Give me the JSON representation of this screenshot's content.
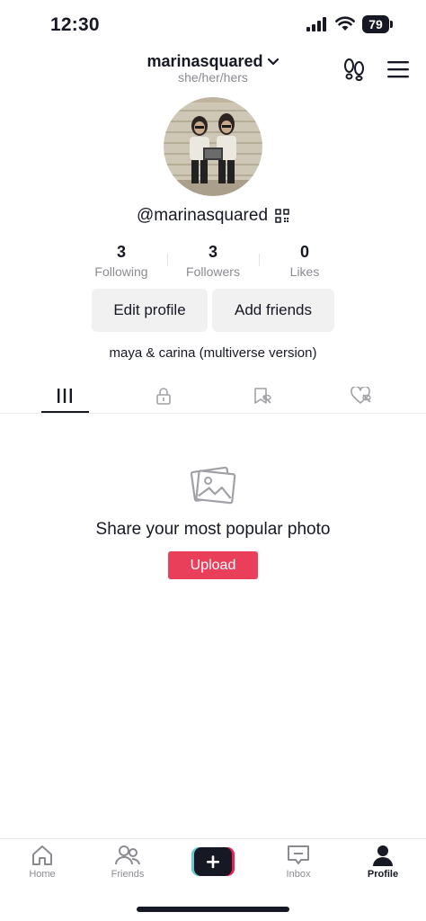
{
  "status_bar": {
    "time": "12:30",
    "battery": "79"
  },
  "header": {
    "username": "marinasquared",
    "pronouns": "she/her/hers"
  },
  "profile": {
    "handle": "@marinasquared",
    "bio": "maya & carina (multiverse version)"
  },
  "stats": [
    {
      "value": "3",
      "label": "Following"
    },
    {
      "value": "3",
      "label": "Followers"
    },
    {
      "value": "0",
      "label": "Likes"
    }
  ],
  "actions": {
    "edit_profile": "Edit profile",
    "add_friends": "Add friends"
  },
  "tabs": [
    {
      "icon": "grid-icon",
      "active": true
    },
    {
      "icon": "lock-icon",
      "active": false
    },
    {
      "icon": "bookmark-icon",
      "active": false
    },
    {
      "icon": "heart-icon",
      "active": false
    }
  ],
  "empty_state": {
    "title": "Share your most popular photo",
    "button": "Upload"
  },
  "bottom_nav": [
    {
      "label": "Home",
      "icon": "home-icon"
    },
    {
      "label": "Friends",
      "icon": "friends-icon"
    },
    {
      "label": "",
      "icon": "plus-icon"
    },
    {
      "label": "Inbox",
      "icon": "inbox-icon"
    },
    {
      "label": "Profile",
      "icon": "profile-icon"
    }
  ],
  "colors": {
    "accent": "#ea3f5b",
    "text": "#161823",
    "muted": "#8a8b91",
    "button_bg": "#f1f1f2"
  }
}
